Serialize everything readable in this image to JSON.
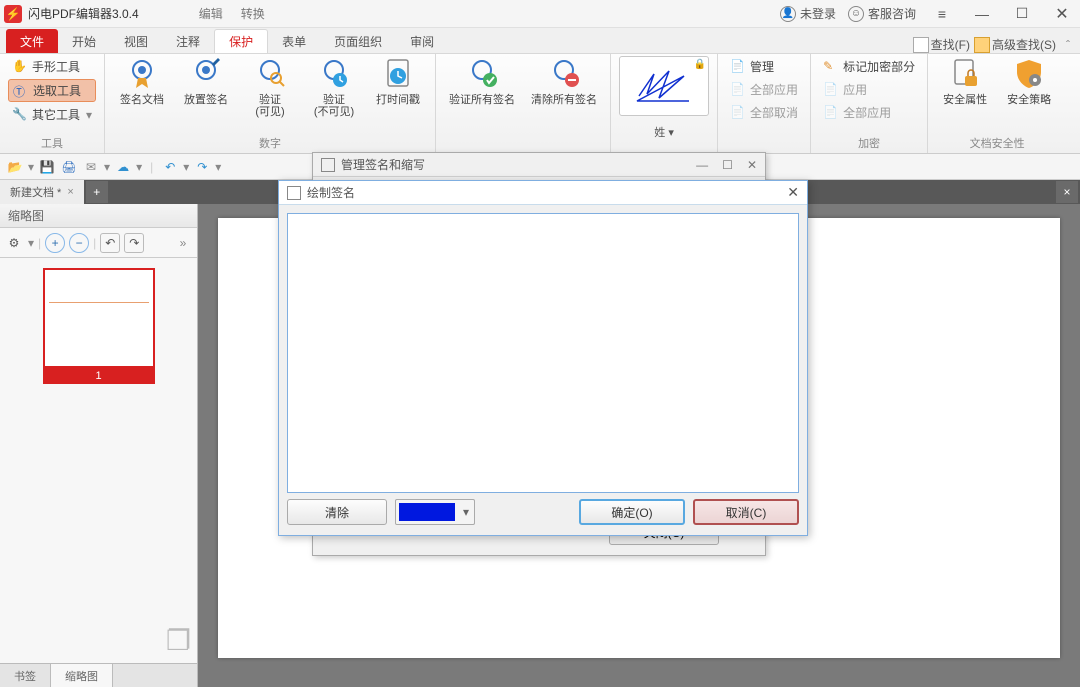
{
  "app": {
    "title": "闪电PDF编辑器3.0.4"
  },
  "topmid": {
    "edit": "编辑",
    "convert": "转换"
  },
  "topright": {
    "login": "未登录",
    "support": "客服咨询"
  },
  "tabs": {
    "file": "文件",
    "start": "开始",
    "view": "视图",
    "annotate": "注释",
    "protect": "保护",
    "form": "表单",
    "page": "页面组织",
    "review": "审阅"
  },
  "ribright": {
    "find": "查找(F)",
    "advfind": "高级查找(S)"
  },
  "tools": {
    "hand": "手形工具",
    "select": "选取工具",
    "other": "其它工具",
    "caption": "工具"
  },
  "sign": {
    "doc": "签名文档",
    "place": "放置签名",
    "verify": "验证\n(可见)",
    "verify2": "验证\n(不可见)",
    "timestamp": "打时间戳",
    "verifyall": "验证所有签名",
    "clearall": "清除所有签名",
    "digi_caption": "数字",
    "preview": "姓"
  },
  "manage": {
    "title": "管理",
    "applyall": "全部应用",
    "cancelall": "全部取消",
    "mark": "标记加密部分",
    "apply": "应用",
    "applyall2": "全部应用",
    "caption": "加密"
  },
  "sec": {
    "attr": "安全属性",
    "policy": "安全策略",
    "caption": "文档安全性"
  },
  "doctab": {
    "name": "新建文档 *"
  },
  "side": {
    "title": "缩略图",
    "page1": "1",
    "bookmark": "书签",
    "thumb": "缩略图"
  },
  "dlg_manage": {
    "title": "管理签名和缩写",
    "close": "关闭(C)"
  },
  "dlg_draw": {
    "title": "绘制签名",
    "clear": "清除",
    "ok": "确定(O)",
    "cancel": "取消(C)"
  }
}
